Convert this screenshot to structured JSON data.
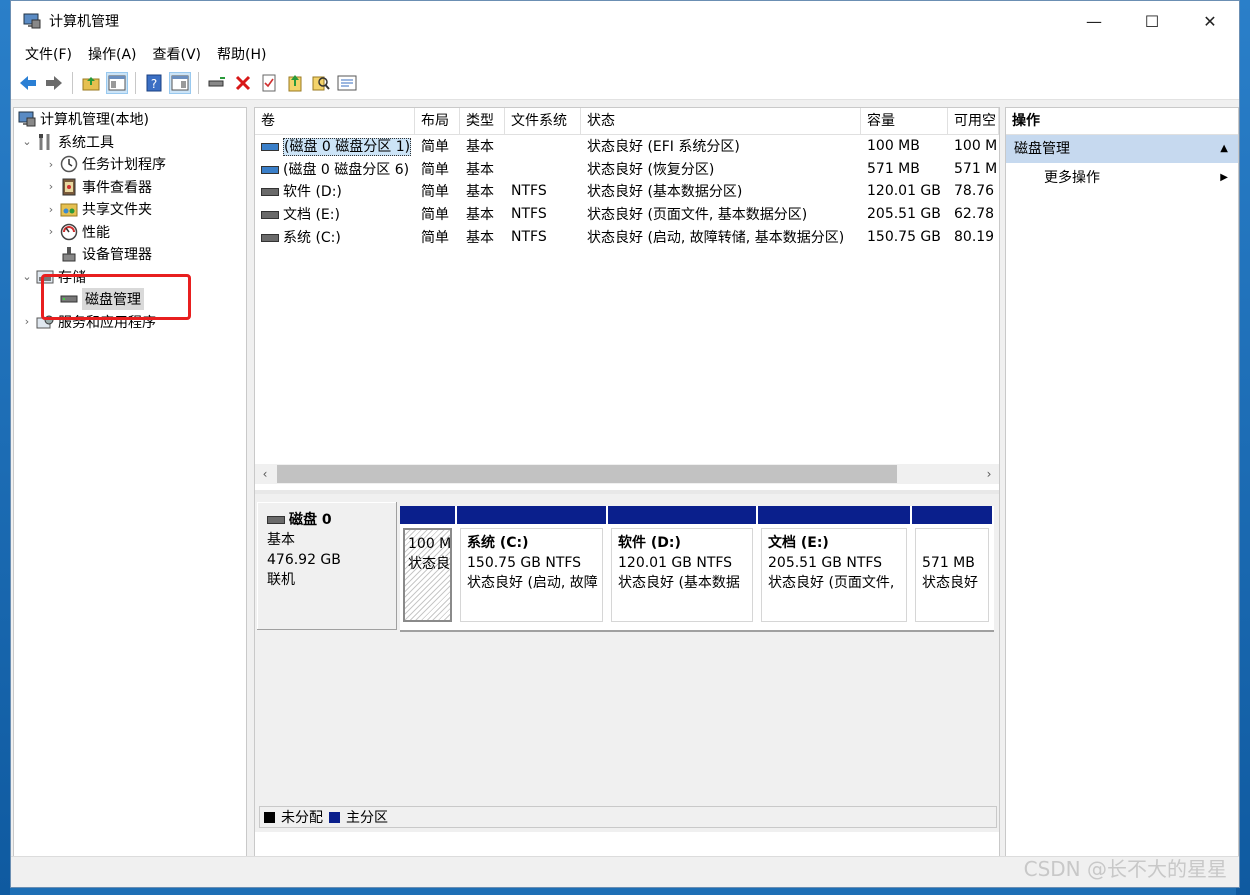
{
  "window": {
    "title": "计算机管理",
    "minimize": "—",
    "maximize": "☐",
    "close": "✕"
  },
  "menu": [
    "文件(F)",
    "操作(A)",
    "查看(V)",
    "帮助(H)"
  ],
  "toolbar_icons": [
    "back-icon",
    "forward-icon",
    "up-folder-icon",
    "show-hide-tree-icon",
    "help-icon",
    "show-hide-action-pane-icon",
    "connect-drive-icon",
    "delete-icon",
    "properties-icon",
    "export-icon",
    "search-icon",
    "list-icon"
  ],
  "tree": {
    "root": "计算机管理(本地)",
    "system_tools": "系统工具",
    "task_scheduler": "任务计划程序",
    "event_viewer": "事件查看器",
    "shared_folders": "共享文件夹",
    "performance": "性能",
    "device_manager": "设备管理器",
    "storage": "存储",
    "disk_management": "磁盘管理",
    "services": "服务和应用程序"
  },
  "volume_table": {
    "headers": [
      "卷",
      "布局",
      "类型",
      "文件系统",
      "状态",
      "容量",
      "可用空"
    ],
    "rows": [
      [
        "(磁盘 0 磁盘分区 1)",
        "简单",
        "基本",
        "",
        "状态良好 (EFI 系统分区)",
        "100 MB",
        "100 M"
      ],
      [
        "(磁盘 0 磁盘分区 6)",
        "简单",
        "基本",
        "",
        "状态良好 (恢复分区)",
        "571 MB",
        "571 M"
      ],
      [
        "软件 (D:)",
        "简单",
        "基本",
        "NTFS",
        "状态良好 (基本数据分区)",
        "120.01 GB",
        "78.76"
      ],
      [
        "文档 (E:)",
        "简单",
        "基本",
        "NTFS",
        "状态良好 (页面文件, 基本数据分区)",
        "205.51 GB",
        "62.78"
      ],
      [
        "系统 (C:)",
        "简单",
        "基本",
        "NTFS",
        "状态良好 (启动, 故障转储, 基本数据分区)",
        "150.75 GB",
        "80.19"
      ]
    ]
  },
  "disk": {
    "name": "磁盘 0",
    "type": "基本",
    "size": "476.92 GB",
    "status": "联机",
    "partitions": [
      {
        "title": "",
        "size": "100 M",
        "status": "状态良",
        "hatched": true
      },
      {
        "title": "系统 (C:)",
        "size": "150.75 GB NTFS",
        "status": "状态良好 (启动, 故障"
      },
      {
        "title": "软件 (D:)",
        "size": "120.01 GB NTFS",
        "status": "状态良好 (基本数据"
      },
      {
        "title": "文档 (E:)",
        "size": "205.51 GB NTFS",
        "status": "状态良好 (页面文件,"
      },
      {
        "title": "",
        "size": "571 MB",
        "status": "状态良好"
      }
    ]
  },
  "legend": {
    "unallocated": "未分配",
    "primary": "主分区",
    "unallocated_color": "#000000",
    "primary_color": "#0a1f8c"
  },
  "actions": {
    "header": "操作",
    "section": "磁盘管理",
    "more": "更多操作"
  },
  "watermark": "CSDN @长不大的星星"
}
